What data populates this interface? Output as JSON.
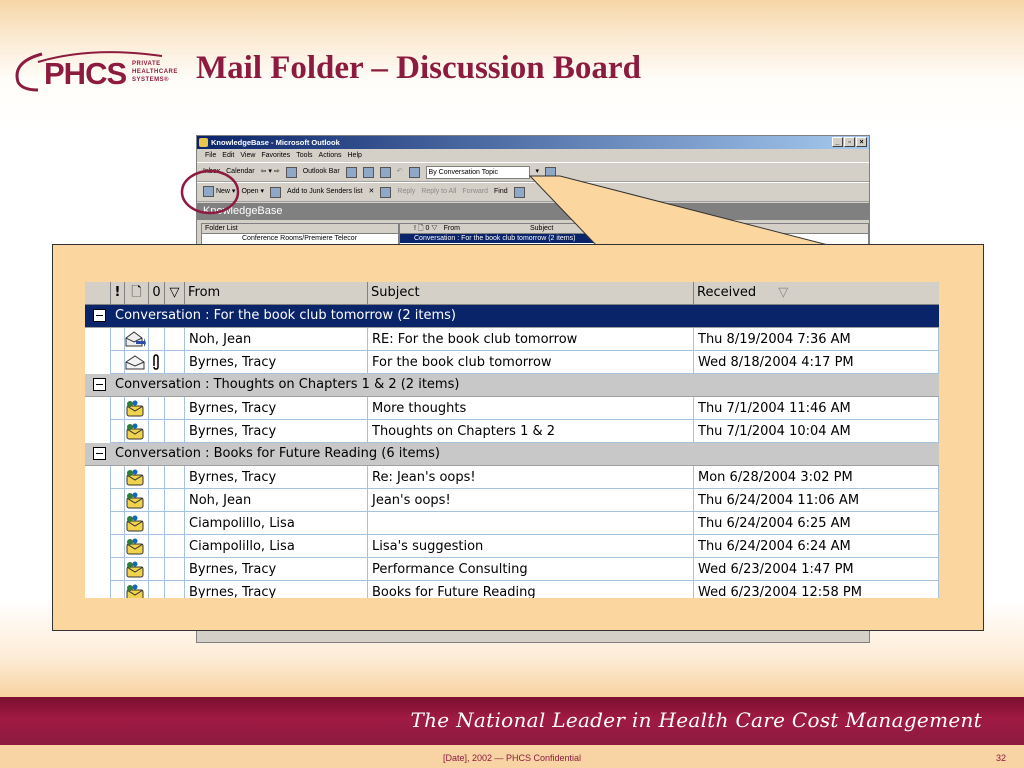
{
  "slide": {
    "title": "Mail Folder – Discussion Board",
    "logo": "PHCS",
    "logo_sub": "PRIVATE\nHEALTHCARE\nSYSTEMS®",
    "tagline": "The National Leader in Health Care Cost Management",
    "footer": "[Date], 2002 — PHCS Confidential",
    "page_number": "32"
  },
  "colors": {
    "brand": "#8c1b3f",
    "panel": "#fbd79f",
    "selected_row": "#0a246a",
    "group_row": "#c8c8c8"
  },
  "outlook": {
    "window_title": "KnowledgeBase - Microsoft Outlook",
    "menu": [
      "File",
      "Edit",
      "View",
      "Favorites",
      "Tools",
      "Actions",
      "Help"
    ],
    "toolbar1": {
      "inbox": "Inbox",
      "calendar": "Calendar",
      "outlook_bar": "Outlook Bar",
      "view_combo": "By Conversation Topic"
    },
    "toolbar2": {
      "new": "New",
      "open": "Open",
      "junk": "Add to Junk Senders list",
      "reply": "Reply",
      "reply_all": "Reply to All",
      "forward": "Forward",
      "find": "Find"
    },
    "folder_name": "KnowledgeBase",
    "folder_list_label": "Folder List",
    "folder_item": "Conference Rooms/Premiere Telecor",
    "list_hdr_from": "From",
    "list_hdr_subject": "Subject",
    "list_row": "Conversation : For the book club tomorrow (2 items)"
  },
  "zoom": {
    "columns": {
      "importance": "!",
      "icon": "🗋",
      "attach": "0",
      "flag": "▽",
      "from": "From",
      "subject": "Subject",
      "received": "Received",
      "sort_arrow": "▽"
    },
    "groups": [
      {
        "label": "Conversation : For the book club tomorrow (2 items)",
        "selected": true,
        "items": [
          {
            "icon": "read-reply-icon",
            "attach": "",
            "from": "Noh, Jean",
            "subject": "RE: For the book club tomorrow",
            "received": "Thu 8/19/2004 7:36 AM"
          },
          {
            "icon": "open-envelope-icon",
            "attach": "0",
            "from": "Byrnes, Tracy",
            "subject": "For the book club tomorrow",
            "received": "Wed 8/18/2004 4:17 PM"
          }
        ]
      },
      {
        "label": "Conversation : Thoughts on Chapters 1 & 2 (2 items)",
        "selected": false,
        "items": [
          {
            "icon": "post-icon",
            "attach": "",
            "from": "Byrnes, Tracy",
            "subject": "More thoughts",
            "received": "Thu 7/1/2004 11:46 AM"
          },
          {
            "icon": "post-icon",
            "attach": "",
            "from": "Byrnes, Tracy",
            "subject": "Thoughts on Chapters 1 & 2",
            "received": "Thu 7/1/2004 10:04 AM"
          }
        ]
      },
      {
        "label": "Conversation : Books for Future Reading (6 items)",
        "selected": false,
        "items": [
          {
            "icon": "post-icon",
            "attach": "",
            "from": "Byrnes, Tracy",
            "subject": "Re: Jean's oops!",
            "received": "Mon 6/28/2004 3:02 PM"
          },
          {
            "icon": "post-icon",
            "attach": "",
            "from": "Noh, Jean",
            "subject": "Jean's oops!",
            "received": "Thu 6/24/2004 11:06 AM"
          },
          {
            "icon": "post-icon",
            "attach": "",
            "from": "Ciampolillo, Lisa",
            "subject": "",
            "received": "Thu 6/24/2004 6:25 AM"
          },
          {
            "icon": "post-icon",
            "attach": "",
            "from": "Ciampolillo, Lisa",
            "subject": "Lisa's suggestion",
            "received": "Thu 6/24/2004 6:24 AM"
          },
          {
            "icon": "post-icon",
            "attach": "",
            "from": "Byrnes, Tracy",
            "subject": "Performance Consulting",
            "received": "Wed 6/23/2004 1:47 PM"
          },
          {
            "icon": "post-icon",
            "attach": "",
            "from": "Byrnes, Tracy",
            "subject": "Books for Future Reading",
            "received": "Wed 6/23/2004 12:58 PM"
          }
        ]
      }
    ]
  }
}
